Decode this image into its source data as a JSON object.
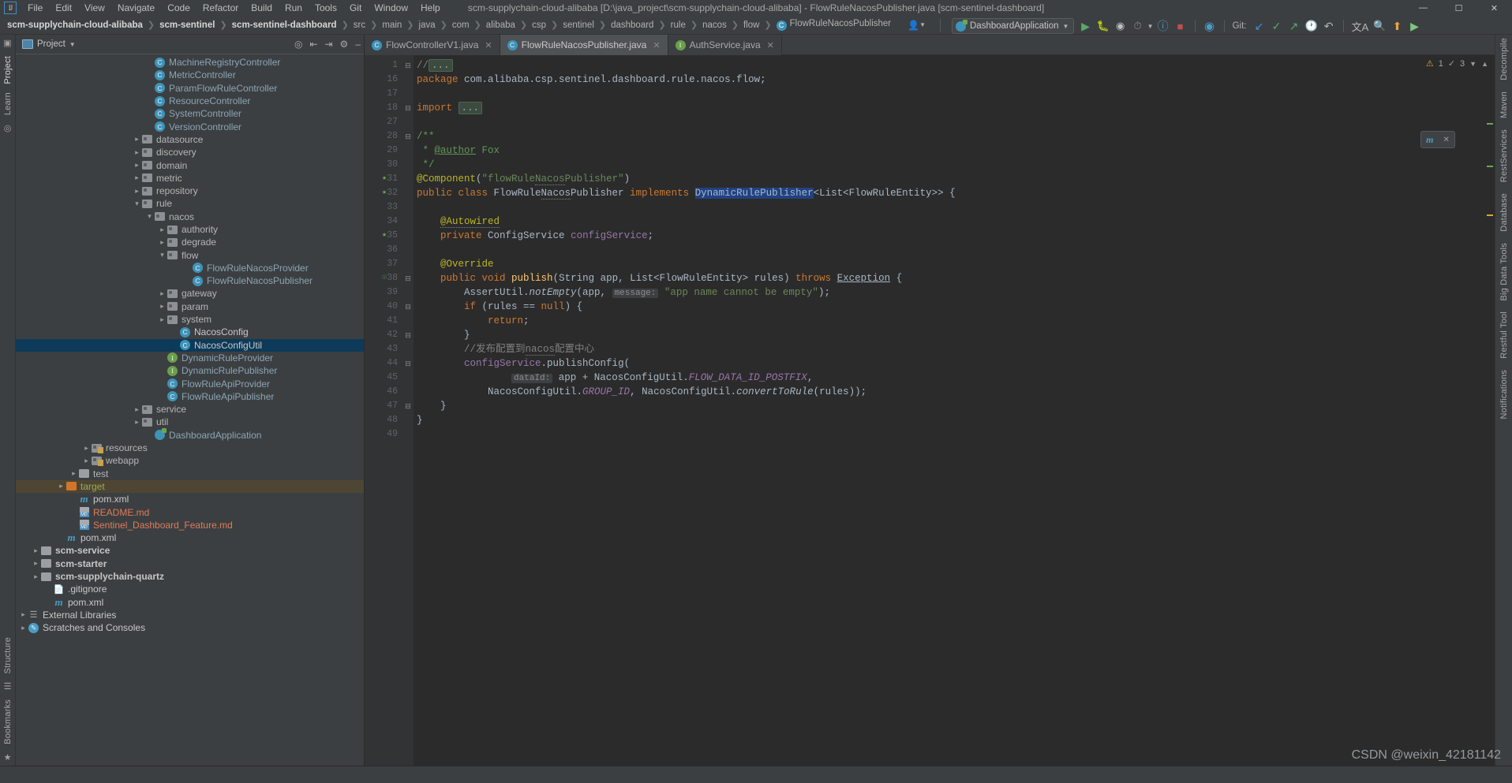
{
  "window": {
    "title": "scm-supplychain-cloud-alibaba [D:\\java_project\\scm-supplychain-cloud-alibaba] - FlowRuleNacosPublisher.java [scm-sentinel-dashboard]",
    "logo": "IJ",
    "minimize": "—",
    "maximize": "☐",
    "close": "✕"
  },
  "menu": [
    "File",
    "Edit",
    "View",
    "Navigate",
    "Code",
    "Refactor",
    "Build",
    "Run",
    "Tools",
    "Git",
    "Window",
    "Help"
  ],
  "breadcrumb": [
    {
      "label": "scm-supplychain-cloud-alibaba",
      "bold": true
    },
    {
      "label": "scm-sentinel",
      "bold": true
    },
    {
      "label": "scm-sentinel-dashboard",
      "bold": true
    },
    {
      "label": "src",
      "bold": false
    },
    {
      "label": "main",
      "bold": false
    },
    {
      "label": "java",
      "bold": false
    },
    {
      "label": "com",
      "bold": false
    },
    {
      "label": "alibaba",
      "bold": false
    },
    {
      "label": "csp",
      "bold": false
    },
    {
      "label": "sentinel",
      "bold": false
    },
    {
      "label": "dashboard",
      "bold": false
    },
    {
      "label": "rule",
      "bold": false
    },
    {
      "label": "nacos",
      "bold": false
    },
    {
      "label": "flow",
      "bold": false
    },
    {
      "label": "FlowRuleNacosPublisher",
      "bold": false,
      "icon": "class-icon"
    }
  ],
  "toolbar": {
    "run_config": "DashboardApplication",
    "git_label": "Git:",
    "icons": [
      "user-dropdown-icon",
      "back-arrow-icon",
      "run-icon",
      "debug-icon",
      "run-coverage-icon",
      "profiler-icon",
      "search-everywhere-icon",
      "stop-icon",
      "idea-assistant-icon",
      "git-update-icon",
      "git-commit-icon",
      "git-push-icon",
      "history-icon",
      "undo-icon",
      "translate-icon",
      "search-icon",
      "upload-icon",
      "play-icon"
    ]
  },
  "project_panel": {
    "title": "Project",
    "tools": [
      "target-icon",
      "collapse-all-icon",
      "expand-icon",
      "settings-icon",
      "hide-icon"
    ],
    "tree": [
      {
        "label": "MachineRegistryController",
        "indent": 10,
        "icon": "class-icon",
        "arrow": "",
        "style": "cls"
      },
      {
        "label": "MetricController",
        "indent": 10,
        "icon": "class-icon",
        "arrow": "",
        "style": "cls"
      },
      {
        "label": "ParamFlowRuleController",
        "indent": 10,
        "icon": "class-icon",
        "arrow": "",
        "style": "cls"
      },
      {
        "label": "ResourceController",
        "indent": 10,
        "icon": "class-icon",
        "arrow": "",
        "style": "cls"
      },
      {
        "label": "SystemController",
        "indent": 10,
        "icon": "class-icon",
        "arrow": "",
        "style": "cls"
      },
      {
        "label": "VersionController",
        "indent": 10,
        "icon": "class-icon",
        "arrow": "",
        "style": "cls"
      },
      {
        "label": "datasource",
        "indent": 9,
        "icon": "folder-icon",
        "arrow": "collapsed",
        "style": ""
      },
      {
        "label": "discovery",
        "indent": 9,
        "icon": "folder-icon",
        "arrow": "collapsed",
        "style": ""
      },
      {
        "label": "domain",
        "indent": 9,
        "icon": "folder-icon",
        "arrow": "collapsed",
        "style": ""
      },
      {
        "label": "metric",
        "indent": 9,
        "icon": "folder-icon",
        "arrow": "collapsed",
        "style": ""
      },
      {
        "label": "repository",
        "indent": 9,
        "icon": "folder-icon",
        "arrow": "collapsed",
        "style": ""
      },
      {
        "label": "rule",
        "indent": 9,
        "icon": "folder-icon",
        "arrow": "expanded",
        "style": ""
      },
      {
        "label": "nacos",
        "indent": 10,
        "icon": "folder-icon",
        "arrow": "expanded",
        "style": ""
      },
      {
        "label": "authority",
        "indent": 11,
        "icon": "folder-icon",
        "arrow": "collapsed",
        "style": ""
      },
      {
        "label": "degrade",
        "indent": 11,
        "icon": "folder-icon",
        "arrow": "collapsed",
        "style": ""
      },
      {
        "label": "flow",
        "indent": 11,
        "icon": "folder-icon",
        "arrow": "expanded",
        "style": ""
      },
      {
        "label": "FlowRuleNacosProvider",
        "indent": 13,
        "icon": "class-icon",
        "arrow": "",
        "style": "cls"
      },
      {
        "label": "FlowRuleNacosPublisher",
        "indent": 13,
        "icon": "class-icon",
        "arrow": "",
        "style": "cls"
      },
      {
        "label": "gateway",
        "indent": 11,
        "icon": "folder-icon",
        "arrow": "collapsed",
        "style": ""
      },
      {
        "label": "param",
        "indent": 11,
        "icon": "folder-icon",
        "arrow": "collapsed",
        "style": ""
      },
      {
        "label": "system",
        "indent": 11,
        "icon": "folder-icon",
        "arrow": "collapsed",
        "style": ""
      },
      {
        "label": "NacosConfig",
        "indent": 12,
        "icon": "class-icon",
        "arrow": "",
        "style": "white"
      },
      {
        "label": "NacosConfigUtil",
        "indent": 12,
        "icon": "class-icon",
        "arrow": "",
        "style": "white",
        "selected": true
      },
      {
        "label": "DynamicRuleProvider",
        "indent": 11,
        "icon": "interface-icon",
        "arrow": "",
        "style": "cls"
      },
      {
        "label": "DynamicRulePublisher",
        "indent": 11,
        "icon": "interface-icon",
        "arrow": "",
        "style": "cls"
      },
      {
        "label": "FlowRuleApiProvider",
        "indent": 11,
        "icon": "class-icon",
        "arrow": "",
        "style": "cls"
      },
      {
        "label": "FlowRuleApiPublisher",
        "indent": 11,
        "icon": "class-icon",
        "arrow": "",
        "style": "cls"
      },
      {
        "label": "service",
        "indent": 9,
        "icon": "folder-icon",
        "arrow": "collapsed",
        "style": ""
      },
      {
        "label": "util",
        "indent": 9,
        "icon": "folder-icon",
        "arrow": "collapsed",
        "style": ""
      },
      {
        "label": "DashboardApplication",
        "indent": 10,
        "icon": "spring-icon",
        "arrow": "",
        "style": "cls"
      },
      {
        "label": "resources",
        "indent": 5,
        "icon": "resources-icon",
        "arrow": "collapsed",
        "style": ""
      },
      {
        "label": "webapp",
        "indent": 5,
        "icon": "resources-icon",
        "arrow": "collapsed",
        "style": ""
      },
      {
        "label": "test",
        "indent": 4,
        "icon": "plain-folder-icon",
        "arrow": "collapsed",
        "style": ""
      },
      {
        "label": "target",
        "indent": 3,
        "icon": "target-folder-icon",
        "arrow": "collapsed",
        "style": "target",
        "highlight": true
      },
      {
        "label": "pom.xml",
        "indent": 4,
        "icon": "maven-icon",
        "arrow": "",
        "style": "white"
      },
      {
        "label": "README.md",
        "indent": 4,
        "icon": "markdown-icon",
        "arrow": "",
        "style": "md"
      },
      {
        "label": "Sentinel_Dashboard_Feature.md",
        "indent": 4,
        "icon": "markdown-icon",
        "arrow": "",
        "style": "md"
      },
      {
        "label": "pom.xml",
        "indent": 3,
        "icon": "maven-icon",
        "arrow": "",
        "style": "white"
      },
      {
        "label": "scm-service",
        "indent": 1,
        "icon": "plain-folder-icon",
        "arrow": "collapsed",
        "style": "strong"
      },
      {
        "label": "scm-starter",
        "indent": 1,
        "icon": "plain-folder-icon",
        "arrow": "collapsed",
        "style": "strong"
      },
      {
        "label": "scm-supplychain-quartz",
        "indent": 1,
        "icon": "plain-folder-icon",
        "arrow": "collapsed",
        "style": "strong"
      },
      {
        "label": ".gitignore",
        "indent": 2,
        "icon": "file-icon",
        "arrow": "",
        "style": "white"
      },
      {
        "label": "pom.xml",
        "indent": 2,
        "icon": "maven-icon",
        "arrow": "",
        "style": "white"
      },
      {
        "label": "External Libraries",
        "indent": 0,
        "icon": "library-icon",
        "arrow": "collapsed",
        "style": "white"
      },
      {
        "label": "Scratches and Consoles",
        "indent": 0,
        "icon": "scratch-icon",
        "arrow": "collapsed",
        "style": "white"
      }
    ]
  },
  "left_rail": [
    "Project",
    "Learn",
    "Structure",
    "Bookmarks"
  ],
  "right_rail": [
    "Decompile",
    "Maven",
    "RestServices",
    "Database",
    "Big Data Tools",
    "Restful Tool",
    "Notifications"
  ],
  "editor": {
    "tabs": [
      {
        "label": "FlowControllerV1.java",
        "icon": "class-icon",
        "active": false
      },
      {
        "label": "FlowRuleNacosPublisher.java",
        "icon": "class-icon",
        "active": true
      },
      {
        "label": "AuthService.java",
        "icon": "interface-icon",
        "active": false
      }
    ],
    "inspection": {
      "warnings": "1",
      "weak_warnings": "3"
    },
    "lines": [
      {
        "num": "1",
        "text": "//...",
        "kind": "collapsed-comment"
      },
      {
        "num": "16",
        "text": "package com.alibaba.csp.sentinel.dashboard.rule.nacos.flow;"
      },
      {
        "num": "17",
        "text": ""
      },
      {
        "num": "18",
        "text": "import ..."
      },
      {
        "num": "27",
        "text": ""
      },
      {
        "num": "28",
        "text": "/**"
      },
      {
        "num": "29",
        "text": " * @author Fox"
      },
      {
        "num": "30",
        "text": " */"
      },
      {
        "num": "31",
        "text": "@Component(\"flowRuleNacosPublisher\")"
      },
      {
        "num": "32",
        "text": "public class FlowRuleNacosPublisher implements DynamicRulePublisher<List<FlowRuleEntity>> {"
      },
      {
        "num": "33",
        "text": ""
      },
      {
        "num": "34",
        "text": "    @Autowired"
      },
      {
        "num": "35",
        "text": "    private ConfigService configService;"
      },
      {
        "num": "36",
        "text": ""
      },
      {
        "num": "37",
        "text": "    @Override"
      },
      {
        "num": "38",
        "text": "    public void publish(String app, List<FlowRuleEntity> rules) throws Exception {"
      },
      {
        "num": "39",
        "text": "        AssertUtil.notEmpty(app, message: \"app name cannot be empty\");"
      },
      {
        "num": "40",
        "text": "        if (rules == null) {"
      },
      {
        "num": "41",
        "text": "            return;"
      },
      {
        "num": "42",
        "text": "        }"
      },
      {
        "num": "43",
        "text": "        //发布配置到nacos配置中心"
      },
      {
        "num": "44",
        "text": "        configService.publishConfig("
      },
      {
        "num": "45",
        "text": "                dataId: app + NacosConfigUtil.FLOW_DATA_ID_POSTFIX,"
      },
      {
        "num": "46",
        "text": "            NacosConfigUtil.GROUP_ID, NacosConfigUtil.convertToRule(rules));"
      },
      {
        "num": "47",
        "text": "    }"
      },
      {
        "num": "48",
        "text": "}"
      },
      {
        "num": "49",
        "text": ""
      }
    ]
  },
  "watermark": "CSDN @weixin_42181142",
  "colors": {
    "accent_blue": "#3e93b9",
    "selection": "#0d3a58",
    "keyword": "#cc7832",
    "string": "#6a8759",
    "annotation": "#bbb529",
    "comment": "#808080",
    "field": "#9876aa",
    "method": "#ffc66d",
    "editor_bg": "#2b2b2b",
    "panel_bg": "#3c3f41"
  }
}
